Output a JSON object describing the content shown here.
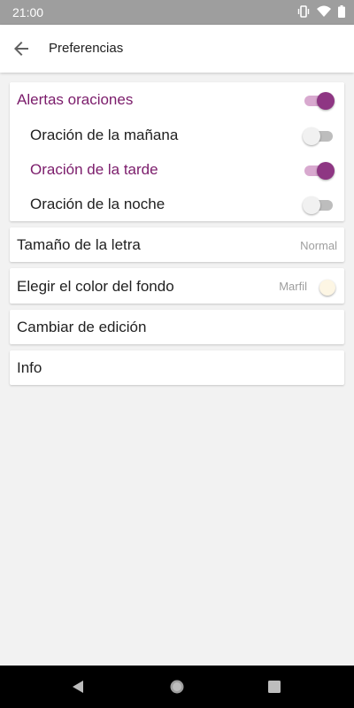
{
  "status_bar": {
    "time": "21:00",
    "icons": [
      "vibrate-icon",
      "wifi-icon",
      "battery-icon"
    ]
  },
  "app_bar": {
    "title": "Preferencias",
    "back_icon": "arrow-left-icon"
  },
  "alerts": {
    "title": "Alertas oraciones",
    "enabled": true,
    "items": [
      {
        "label": "Oración de la mañana",
        "enabled": false
      },
      {
        "label": "Oración de la tarde",
        "enabled": true
      },
      {
        "label": "Oración de la noche",
        "enabled": false
      }
    ]
  },
  "font_size": {
    "label": "Tamaño de la letra",
    "value": "Normal"
  },
  "background_color": {
    "label": "Elegir el color del fondo",
    "value": "Marfil",
    "swatch_color": "#fdf6e4"
  },
  "edition": {
    "label": "Cambiar de edición"
  },
  "info": {
    "label": "Info"
  },
  "colors": {
    "accent": "#7b1c6b",
    "switch_on_thumb": "#8e3683",
    "switch_on_track": "#d8a9cf",
    "status_bar": "#9e9e9e"
  },
  "nav_bar": {
    "icons": [
      "back-triangle-icon",
      "home-circle-icon",
      "recents-square-icon"
    ]
  }
}
